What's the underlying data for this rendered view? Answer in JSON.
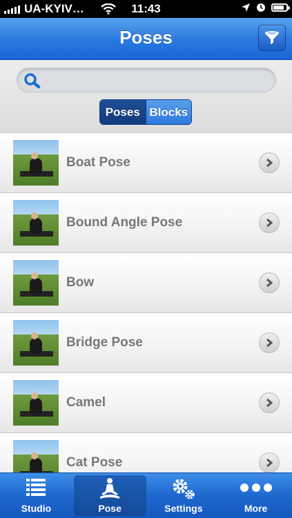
{
  "status_bar": {
    "carrier": "UA-KYIV…",
    "time": "11:43",
    "battery_level": 0.9
  },
  "navbar": {
    "title": "Poses"
  },
  "search": {
    "placeholder": ""
  },
  "segment": {
    "options": [
      "Poses",
      "Blocks"
    ],
    "selected": "Poses"
  },
  "poses": [
    {
      "name": "Boat Pose"
    },
    {
      "name": "Bound Angle Pose"
    },
    {
      "name": "Bow"
    },
    {
      "name": "Bridge Pose"
    },
    {
      "name": "Camel"
    },
    {
      "name": "Cat Pose"
    }
  ],
  "tabbar": {
    "tabs": [
      {
        "label": "Studio",
        "icon": "list-icon"
      },
      {
        "label": "Pose",
        "icon": "meditation-icon"
      },
      {
        "label": "Settings",
        "icon": "gears-icon"
      },
      {
        "label": "More",
        "icon": "more-icon"
      }
    ],
    "selected": "Pose"
  }
}
